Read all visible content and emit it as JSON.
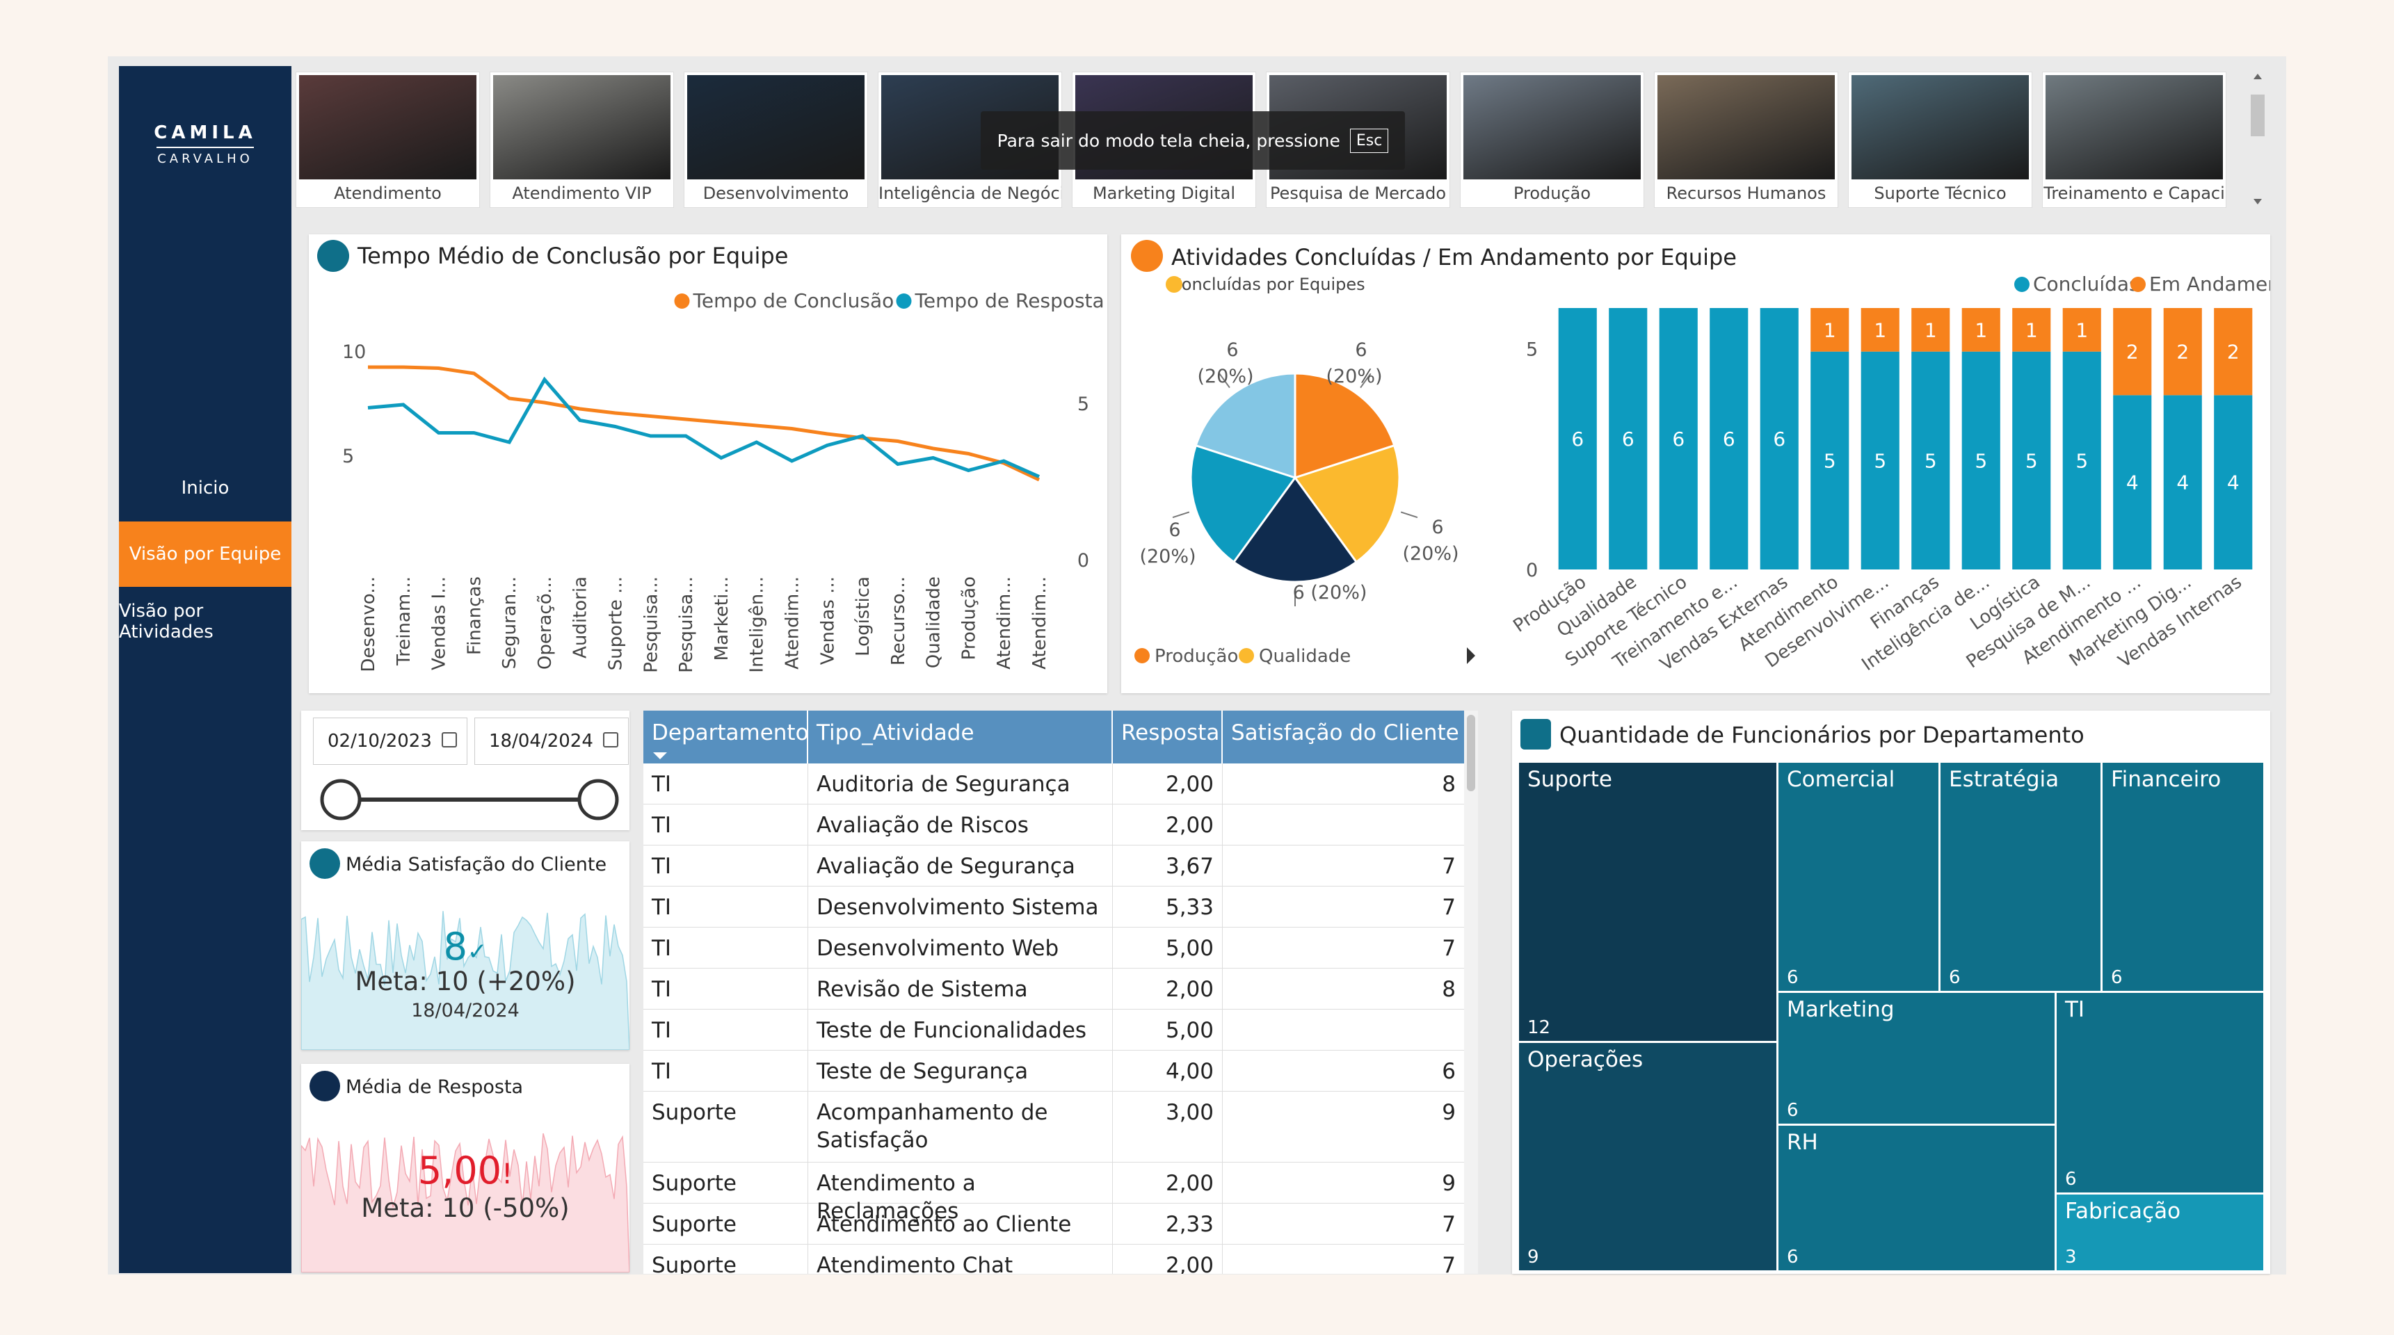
{
  "brand": {
    "line1": "CAMILA",
    "line2": "CARVALHO"
  },
  "nav": [
    {
      "label": "Inicio"
    },
    {
      "label": "Visão por Equipe"
    },
    {
      "label": "Visão por Atividades"
    }
  ],
  "thumbs": [
    {
      "label": "Atendimento",
      "color": "#5a3b3b"
    },
    {
      "label": "Atendimento VIP",
      "color": "#8a8a86"
    },
    {
      "label": "Desenvolvimento",
      "color": "#1b2b3c"
    },
    {
      "label": "Inteligência de Negóci",
      "color": "#2d3e52"
    },
    {
      "label": "Marketing Digital",
      "color": "#3a3452"
    },
    {
      "label": "Pesquisa de Mercado",
      "color": "#5a5e66"
    },
    {
      "label": "Produção",
      "color": "#6f7a86"
    },
    {
      "label": "Recursos Humanos",
      "color": "#7a6a58"
    },
    {
      "label": "Suporte Técnico",
      "color": "#4f6a78"
    },
    {
      "label": "Treinamento e Capaci",
      "color": "#707a80"
    }
  ],
  "fullscreen": {
    "message": "Para sair do modo tela cheia, pressione",
    "key": "Esc"
  },
  "line_chart": {
    "title": "Tempo Médio de Conclusão por Equipe"
  },
  "combo": {
    "title": "Atividades Concluídas / Em Andamento por Equipe",
    "pie_subtitle": "Concluídas por Equipes"
  },
  "filters": {
    "date_start": "02/10/2023",
    "date_end": "18/04/2024"
  },
  "kpi1": {
    "title": "Média Satisfação do Cliente",
    "value": "8",
    "goal": "Meta: 10 (+20%)",
    "date": "18/04/2024",
    "color": "#0d8fa8"
  },
  "kpi2": {
    "title": "Média de Resposta",
    "value": "5,00",
    "mark": "!",
    "goal": "Meta: 10 (-50%)",
    "color": "#e11d2b"
  },
  "table": {
    "columns": [
      "Departamento",
      "Tipo_Atividade",
      "Resposta",
      "Satisfação do Cliente"
    ],
    "rows": [
      [
        "TI",
        "Auditoria de Segurança",
        "2,00",
        "8"
      ],
      [
        "TI",
        "Avaliação de Riscos",
        "2,00",
        ""
      ],
      [
        "TI",
        "Avaliação de Segurança",
        "3,67",
        "7"
      ],
      [
        "TI",
        "Desenvolvimento Sistema",
        "5,33",
        "7"
      ],
      [
        "TI",
        "Desenvolvimento Web",
        "5,00",
        "7"
      ],
      [
        "TI",
        "Revisão de Sistema",
        "2,00",
        "8"
      ],
      [
        "TI",
        "Teste de Funcionalidades",
        "5,00",
        ""
      ],
      [
        "TI",
        "Teste de Segurança",
        "4,00",
        "6"
      ],
      [
        "Suporte",
        "Acompanhamento de Satisfação",
        "3,00",
        "9"
      ],
      [
        "Suporte",
        "Atendimento a Reclamações",
        "2,00",
        "9"
      ],
      [
        "Suporte",
        "Atendimento ao Cliente",
        "2,33",
        "7"
      ],
      [
        "Suporte",
        "Atendimento Chat",
        "2,00",
        "7"
      ]
    ]
  },
  "treemap_title": "Quantidade de Funcionários por Departamento",
  "chart_data": [
    {
      "type": "line",
      "title": "Tempo Médio de Conclusão por Equipe",
      "categories": [
        "Desenvo...",
        "Treinam...",
        "Vendas I...",
        "Finanças",
        "Seguran...",
        "Operaçõ...",
        "Auditoria",
        "Suporte ...",
        "Pesquisa...",
        "Pesquisa...",
        "Marketi...",
        "Inteligên...",
        "Atendim...",
        "Vendas ...",
        "Logística",
        "Recurso...",
        "Qualidade",
        "Produção",
        "Atendim...",
        "Atendim..."
      ],
      "y_left": {
        "ticks": [
          "5",
          "10"
        ],
        "range": [
          0,
          12
        ]
      },
      "y_right": {
        "ticks": [
          "0",
          "5"
        ],
        "range": [
          0,
          8
        ]
      },
      "legend": "top-right",
      "series": [
        {
          "name": "Tempo de Conclusão",
          "color": "#f7821c",
          "axis": "left",
          "values": [
            9.3,
            9.3,
            9.25,
            9.0,
            7.8,
            7.6,
            7.3,
            7.1,
            6.95,
            6.8,
            6.65,
            6.5,
            6.35,
            6.1,
            5.9,
            5.75,
            5.4,
            5.15,
            4.7,
            3.9
          ]
        },
        {
          "name": "Tempo de Resposta",
          "color": "#0d9bbf",
          "axis": "right",
          "values": [
            4.9,
            5.0,
            4.1,
            4.1,
            3.8,
            5.8,
            4.5,
            4.3,
            4.0,
            4.0,
            3.3,
            3.8,
            3.2,
            3.7,
            4.0,
            3.1,
            3.3,
            2.9,
            3.2,
            2.7
          ]
        }
      ]
    },
    {
      "type": "pie",
      "title": "Concluídas por Equipes",
      "legend": [
        "Produção",
        "Qualidade"
      ],
      "slices": [
        {
          "label": "6",
          "pct": "(20%)",
          "value": 6,
          "color": "#f7821c"
        },
        {
          "label": "6",
          "pct": "(20%)",
          "value": 6,
          "color": "#fbb92e"
        },
        {
          "label": "6 (20%)",
          "pct": "",
          "value": 6,
          "color": "#0f2b4e"
        },
        {
          "label": "6",
          "pct": "(20%)",
          "value": 6,
          "color": "#0d9bbf"
        },
        {
          "label": "6",
          "pct": "(20%)",
          "value": 6,
          "color": "#83c6e4"
        }
      ]
    },
    {
      "type": "bar",
      "title": "Atividades Concluídas / Em Andamento por Equipe",
      "categories": [
        "Produção",
        "Qualidade",
        "Suporte Técnico",
        "Treinamento e...",
        "Vendas Externas",
        "Atendimento",
        "Desenvolvime...",
        "Finanças",
        "Inteligência de...",
        "Logística",
        "Pesquisa de M...",
        "Atendimento ...",
        "Marketing Dig...",
        "Vendas Internas"
      ],
      "y_ticks": [
        "0",
        "5"
      ],
      "ylim": [
        0,
        6
      ],
      "legend": "top-right",
      "series": [
        {
          "name": "Concluídas",
          "color": "#0d9bbf",
          "values": [
            6,
            6,
            6,
            6,
            6,
            5,
            5,
            5,
            5,
            5,
            5,
            4,
            4,
            4
          ]
        },
        {
          "name": "Em Andamento",
          "color": "#f7821c",
          "values": [
            0,
            0,
            0,
            0,
            0,
            1,
            1,
            1,
            1,
            1,
            1,
            2,
            2,
            2
          ]
        }
      ]
    },
    {
      "type": "treemap",
      "title": "Quantidade de Funcionários por Departamento",
      "items": [
        {
          "name": "Suporte",
          "value": 12,
          "color": "#0e3a52"
        },
        {
          "name": "Operações",
          "value": 9,
          "color": "#0f4a63"
        },
        {
          "name": "Comercial",
          "value": 6,
          "color": "#0f6f89"
        },
        {
          "name": "Estratégia",
          "value": 6,
          "color": "#0f6f89"
        },
        {
          "name": "Financeiro",
          "value": 6,
          "color": "#0f6f89"
        },
        {
          "name": "Marketing",
          "value": 6,
          "color": "#0f6f89"
        },
        {
          "name": "RH",
          "value": 6,
          "color": "#0f6f89"
        },
        {
          "name": "TI",
          "value": 6,
          "color": "#0f6f89"
        },
        {
          "name": "Fabricação",
          "value": 3,
          "color": "#1598b6"
        }
      ]
    }
  ]
}
